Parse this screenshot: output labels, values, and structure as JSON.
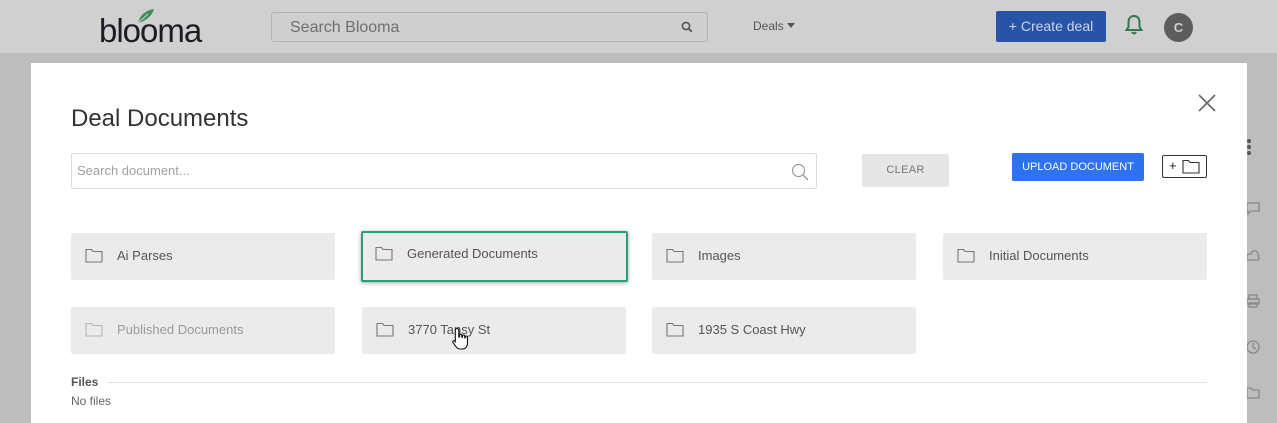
{
  "header": {
    "logo_text": "blooma",
    "search_placeholder": "Search Blooma",
    "deals_label": "Deals",
    "create_deal_label": "+ Create deal",
    "avatar_initial": "C"
  },
  "modal": {
    "title": "Deal Documents",
    "search_placeholder": "Search document...",
    "clear_label": "CLEAR",
    "upload_label": "UPLOAD DOCUMENT",
    "new_folder_plus": "+",
    "folders": [
      {
        "label": "Ai Parses"
      },
      {
        "label": "Generated Documents"
      },
      {
        "label": "Images"
      },
      {
        "label": "Initial Documents"
      },
      {
        "label": "Published Documents"
      },
      {
        "label": "3770 Tansy St"
      },
      {
        "label": "1935 S Coast Hwy"
      }
    ],
    "files_heading": "Files",
    "files_empty": "No files"
  },
  "colors": {
    "accent": "#2e72f0",
    "selected_border": "#24a07d",
    "create_deal_bg": "#2853a7"
  }
}
